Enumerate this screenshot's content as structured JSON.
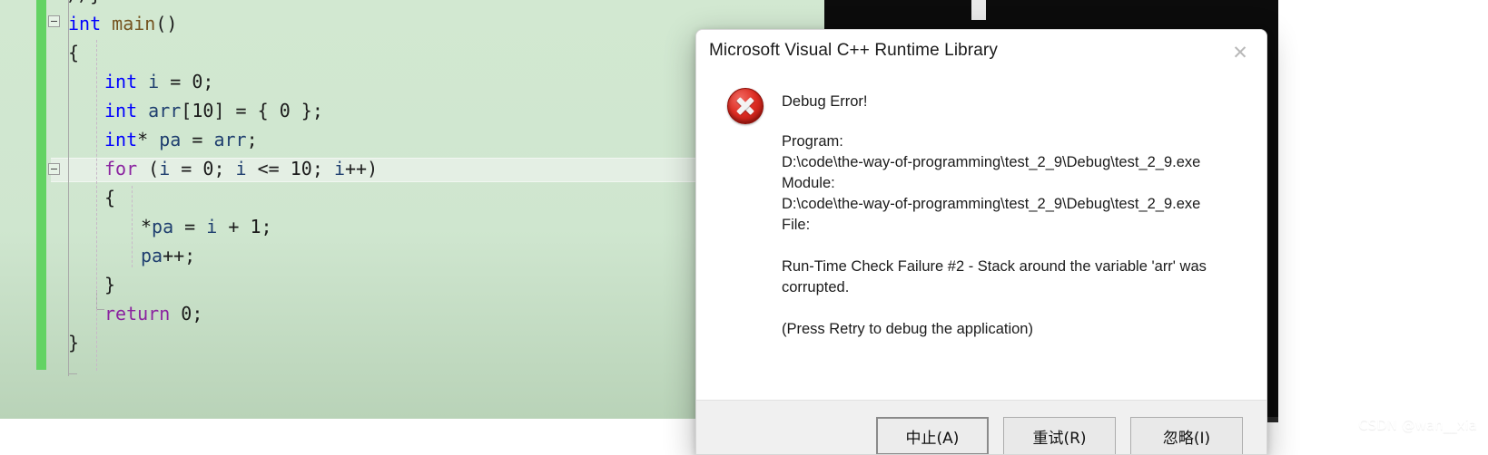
{
  "editor": {
    "name": "code-editor",
    "language": "C",
    "background_color": "#cfe6cf",
    "change_bar_color": "#63d363",
    "current_line_number": 6,
    "lines": [
      {
        "indent": 0,
        "tokens": [
          {
            "t": "//}",
            "c": "t-punct"
          }
        ],
        "clipped": true
      },
      {
        "indent": 0,
        "tokens": [
          {
            "t": "int",
            "c": "t-kw"
          },
          {
            "t": " ",
            "c": "t-punct"
          },
          {
            "t": "main",
            "c": "t-fn"
          },
          {
            "t": "()",
            "c": "t-punct"
          }
        ]
      },
      {
        "indent": 0,
        "tokens": [
          {
            "t": "{",
            "c": "t-punct"
          }
        ]
      },
      {
        "indent": 1,
        "tokens": [
          {
            "t": "int",
            "c": "t-kw"
          },
          {
            "t": " ",
            "c": "t-punct"
          },
          {
            "t": "i",
            "c": "t-ident"
          },
          {
            "t": " = ",
            "c": "t-punct"
          },
          {
            "t": "0",
            "c": "t-num"
          },
          {
            "t": ";",
            "c": "t-punct"
          }
        ]
      },
      {
        "indent": 1,
        "tokens": [
          {
            "t": "int",
            "c": "t-kw"
          },
          {
            "t": " ",
            "c": "t-punct"
          },
          {
            "t": "arr",
            "c": "t-ident"
          },
          {
            "t": "[",
            "c": "t-punct"
          },
          {
            "t": "10",
            "c": "t-num"
          },
          {
            "t": "] = { ",
            "c": "t-punct"
          },
          {
            "t": "0",
            "c": "t-num"
          },
          {
            "t": " };",
            "c": "t-punct"
          }
        ]
      },
      {
        "indent": 1,
        "tokens": [
          {
            "t": "int",
            "c": "t-kw"
          },
          {
            "t": "* ",
            "c": "t-punct"
          },
          {
            "t": "pa",
            "c": "t-ident"
          },
          {
            "t": " = ",
            "c": "t-punct"
          },
          {
            "t": "arr",
            "c": "t-ident"
          },
          {
            "t": ";",
            "c": "t-punct"
          }
        ]
      },
      {
        "indent": 1,
        "tokens": [
          {
            "t": "for",
            "c": "t-kwc"
          },
          {
            "t": " (",
            "c": "t-punct"
          },
          {
            "t": "i",
            "c": "t-ident"
          },
          {
            "t": " = ",
            "c": "t-punct"
          },
          {
            "t": "0",
            "c": "t-num"
          },
          {
            "t": "; ",
            "c": "t-punct"
          },
          {
            "t": "i",
            "c": "t-ident"
          },
          {
            "t": " <= ",
            "c": "t-punct"
          },
          {
            "t": "10",
            "c": "t-num"
          },
          {
            "t": "; ",
            "c": "t-punct"
          },
          {
            "t": "i",
            "c": "t-ident"
          },
          {
            "t": "++)",
            "c": "t-punct"
          }
        ]
      },
      {
        "indent": 1,
        "tokens": [
          {
            "t": "{",
            "c": "t-punct"
          }
        ]
      },
      {
        "indent": 2,
        "tokens": [
          {
            "t": "*",
            "c": "t-punct"
          },
          {
            "t": "pa",
            "c": "t-ident"
          },
          {
            "t": " = ",
            "c": "t-punct"
          },
          {
            "t": "i",
            "c": "t-ident"
          },
          {
            "t": " + ",
            "c": "t-punct"
          },
          {
            "t": "1",
            "c": "t-num"
          },
          {
            "t": ";",
            "c": "t-punct"
          }
        ]
      },
      {
        "indent": 2,
        "tokens": [
          {
            "t": "pa",
            "c": "t-ident"
          },
          {
            "t": "++;",
            "c": "t-punct"
          }
        ]
      },
      {
        "indent": 1,
        "tokens": [
          {
            "t": "}",
            "c": "t-punct"
          }
        ]
      },
      {
        "indent": 1,
        "tokens": [
          {
            "t": "return",
            "c": "t-kwc"
          },
          {
            "t": " ",
            "c": "t-punct"
          },
          {
            "t": "0",
            "c": "t-num"
          },
          {
            "t": ";",
            "c": "t-punct"
          }
        ]
      },
      {
        "indent": 0,
        "tokens": [
          {
            "t": "}",
            "c": "t-punct"
          }
        ]
      }
    ]
  },
  "console": {
    "name": "console-window",
    "background_color": "#0c0c0c",
    "cursor_visible": true
  },
  "dialog": {
    "title": "Microsoft Visual C++ Runtime Library",
    "close_icon": "close-icon",
    "close_glyph": "✕",
    "icon": "error-icon",
    "heading": "Debug Error!",
    "program_label": "Program:",
    "program_path": "D:\\code\\the-way-of-programming\\test_2_9\\Debug\\test_2_9.exe",
    "module_label": "Module:",
    "module_path": "D:\\code\\the-way-of-programming\\test_2_9\\Debug\\test_2_9.exe",
    "file_label": "File:",
    "failure_message": "Run-Time Check Failure #2 - Stack around the variable 'arr' was corrupted.",
    "hint_message": "(Press Retry to debug the application)",
    "buttons": [
      {
        "label": "中止(A)",
        "name": "abort-button",
        "default": true
      },
      {
        "label": "重试(R)",
        "name": "retry-button",
        "default": false
      },
      {
        "label": "忽略(I)",
        "name": "ignore-button",
        "default": false
      }
    ]
  },
  "watermark": {
    "text": "CSDN @wan__xia"
  }
}
